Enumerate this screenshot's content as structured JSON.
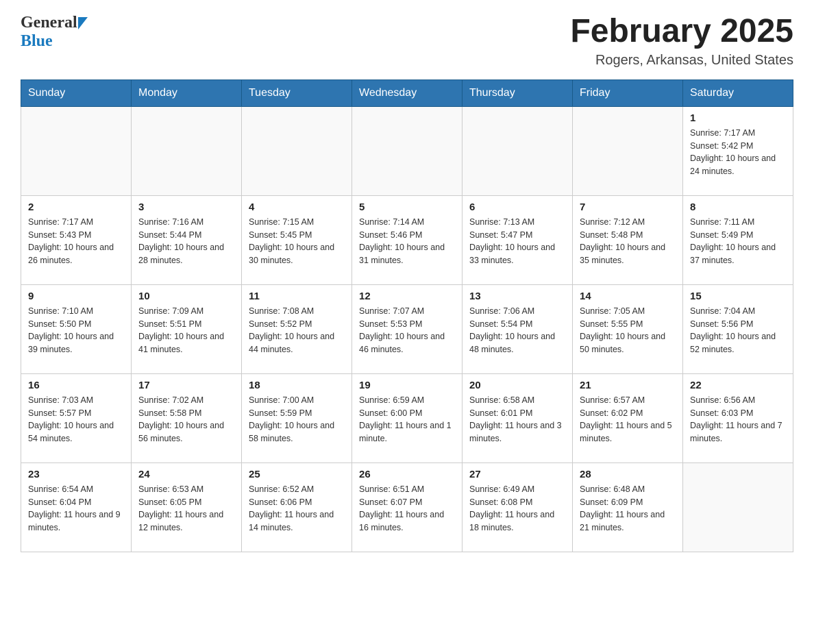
{
  "header": {
    "logo_general": "General",
    "logo_blue": "Blue",
    "month_title": "February 2025",
    "location": "Rogers, Arkansas, United States"
  },
  "weekdays": [
    "Sunday",
    "Monday",
    "Tuesday",
    "Wednesday",
    "Thursday",
    "Friday",
    "Saturday"
  ],
  "weeks": [
    [
      {
        "day": "",
        "sunrise": "",
        "sunset": "",
        "daylight": ""
      },
      {
        "day": "",
        "sunrise": "",
        "sunset": "",
        "daylight": ""
      },
      {
        "day": "",
        "sunrise": "",
        "sunset": "",
        "daylight": ""
      },
      {
        "day": "",
        "sunrise": "",
        "sunset": "",
        "daylight": ""
      },
      {
        "day": "",
        "sunrise": "",
        "sunset": "",
        "daylight": ""
      },
      {
        "day": "",
        "sunrise": "",
        "sunset": "",
        "daylight": ""
      },
      {
        "day": "1",
        "sunrise": "Sunrise: 7:17 AM",
        "sunset": "Sunset: 5:42 PM",
        "daylight": "Daylight: 10 hours and 24 minutes."
      }
    ],
    [
      {
        "day": "2",
        "sunrise": "Sunrise: 7:17 AM",
        "sunset": "Sunset: 5:43 PM",
        "daylight": "Daylight: 10 hours and 26 minutes."
      },
      {
        "day": "3",
        "sunrise": "Sunrise: 7:16 AM",
        "sunset": "Sunset: 5:44 PM",
        "daylight": "Daylight: 10 hours and 28 minutes."
      },
      {
        "day": "4",
        "sunrise": "Sunrise: 7:15 AM",
        "sunset": "Sunset: 5:45 PM",
        "daylight": "Daylight: 10 hours and 30 minutes."
      },
      {
        "day": "5",
        "sunrise": "Sunrise: 7:14 AM",
        "sunset": "Sunset: 5:46 PM",
        "daylight": "Daylight: 10 hours and 31 minutes."
      },
      {
        "day": "6",
        "sunrise": "Sunrise: 7:13 AM",
        "sunset": "Sunset: 5:47 PM",
        "daylight": "Daylight: 10 hours and 33 minutes."
      },
      {
        "day": "7",
        "sunrise": "Sunrise: 7:12 AM",
        "sunset": "Sunset: 5:48 PM",
        "daylight": "Daylight: 10 hours and 35 minutes."
      },
      {
        "day": "8",
        "sunrise": "Sunrise: 7:11 AM",
        "sunset": "Sunset: 5:49 PM",
        "daylight": "Daylight: 10 hours and 37 minutes."
      }
    ],
    [
      {
        "day": "9",
        "sunrise": "Sunrise: 7:10 AM",
        "sunset": "Sunset: 5:50 PM",
        "daylight": "Daylight: 10 hours and 39 minutes."
      },
      {
        "day": "10",
        "sunrise": "Sunrise: 7:09 AM",
        "sunset": "Sunset: 5:51 PM",
        "daylight": "Daylight: 10 hours and 41 minutes."
      },
      {
        "day": "11",
        "sunrise": "Sunrise: 7:08 AM",
        "sunset": "Sunset: 5:52 PM",
        "daylight": "Daylight: 10 hours and 44 minutes."
      },
      {
        "day": "12",
        "sunrise": "Sunrise: 7:07 AM",
        "sunset": "Sunset: 5:53 PM",
        "daylight": "Daylight: 10 hours and 46 minutes."
      },
      {
        "day": "13",
        "sunrise": "Sunrise: 7:06 AM",
        "sunset": "Sunset: 5:54 PM",
        "daylight": "Daylight: 10 hours and 48 minutes."
      },
      {
        "day": "14",
        "sunrise": "Sunrise: 7:05 AM",
        "sunset": "Sunset: 5:55 PM",
        "daylight": "Daylight: 10 hours and 50 minutes."
      },
      {
        "day": "15",
        "sunrise": "Sunrise: 7:04 AM",
        "sunset": "Sunset: 5:56 PM",
        "daylight": "Daylight: 10 hours and 52 minutes."
      }
    ],
    [
      {
        "day": "16",
        "sunrise": "Sunrise: 7:03 AM",
        "sunset": "Sunset: 5:57 PM",
        "daylight": "Daylight: 10 hours and 54 minutes."
      },
      {
        "day": "17",
        "sunrise": "Sunrise: 7:02 AM",
        "sunset": "Sunset: 5:58 PM",
        "daylight": "Daylight: 10 hours and 56 minutes."
      },
      {
        "day": "18",
        "sunrise": "Sunrise: 7:00 AM",
        "sunset": "Sunset: 5:59 PM",
        "daylight": "Daylight: 10 hours and 58 minutes."
      },
      {
        "day": "19",
        "sunrise": "Sunrise: 6:59 AM",
        "sunset": "Sunset: 6:00 PM",
        "daylight": "Daylight: 11 hours and 1 minute."
      },
      {
        "day": "20",
        "sunrise": "Sunrise: 6:58 AM",
        "sunset": "Sunset: 6:01 PM",
        "daylight": "Daylight: 11 hours and 3 minutes."
      },
      {
        "day": "21",
        "sunrise": "Sunrise: 6:57 AM",
        "sunset": "Sunset: 6:02 PM",
        "daylight": "Daylight: 11 hours and 5 minutes."
      },
      {
        "day": "22",
        "sunrise": "Sunrise: 6:56 AM",
        "sunset": "Sunset: 6:03 PM",
        "daylight": "Daylight: 11 hours and 7 minutes."
      }
    ],
    [
      {
        "day": "23",
        "sunrise": "Sunrise: 6:54 AM",
        "sunset": "Sunset: 6:04 PM",
        "daylight": "Daylight: 11 hours and 9 minutes."
      },
      {
        "day": "24",
        "sunrise": "Sunrise: 6:53 AM",
        "sunset": "Sunset: 6:05 PM",
        "daylight": "Daylight: 11 hours and 12 minutes."
      },
      {
        "day": "25",
        "sunrise": "Sunrise: 6:52 AM",
        "sunset": "Sunset: 6:06 PM",
        "daylight": "Daylight: 11 hours and 14 minutes."
      },
      {
        "day": "26",
        "sunrise": "Sunrise: 6:51 AM",
        "sunset": "Sunset: 6:07 PM",
        "daylight": "Daylight: 11 hours and 16 minutes."
      },
      {
        "day": "27",
        "sunrise": "Sunrise: 6:49 AM",
        "sunset": "Sunset: 6:08 PM",
        "daylight": "Daylight: 11 hours and 18 minutes."
      },
      {
        "day": "28",
        "sunrise": "Sunrise: 6:48 AM",
        "sunset": "Sunset: 6:09 PM",
        "daylight": "Daylight: 11 hours and 21 minutes."
      },
      {
        "day": "",
        "sunrise": "",
        "sunset": "",
        "daylight": ""
      }
    ]
  ]
}
